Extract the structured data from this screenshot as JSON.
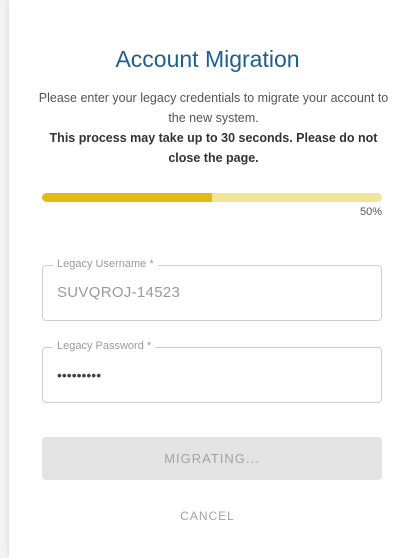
{
  "dialog": {
    "title": "Account Migration",
    "description": "Please enter your legacy credentials to migrate your account to the new system.",
    "warning": "This process may take up to 30 seconds. Please do not close the page."
  },
  "progress": {
    "value": 0.5,
    "label": "50%"
  },
  "fields": {
    "username": {
      "label": "Legacy Username *",
      "value": "SUVQROJ-14523"
    },
    "password": {
      "label": "Legacy Password *",
      "value": "•••••••••"
    }
  },
  "buttons": {
    "migrate_label": "MIGRATING...",
    "cancel_label": "CANCEL"
  },
  "colors": {
    "title": "#1f5f8c",
    "progress_fill": "#e2b918",
    "progress_track": "#f2e59a"
  }
}
